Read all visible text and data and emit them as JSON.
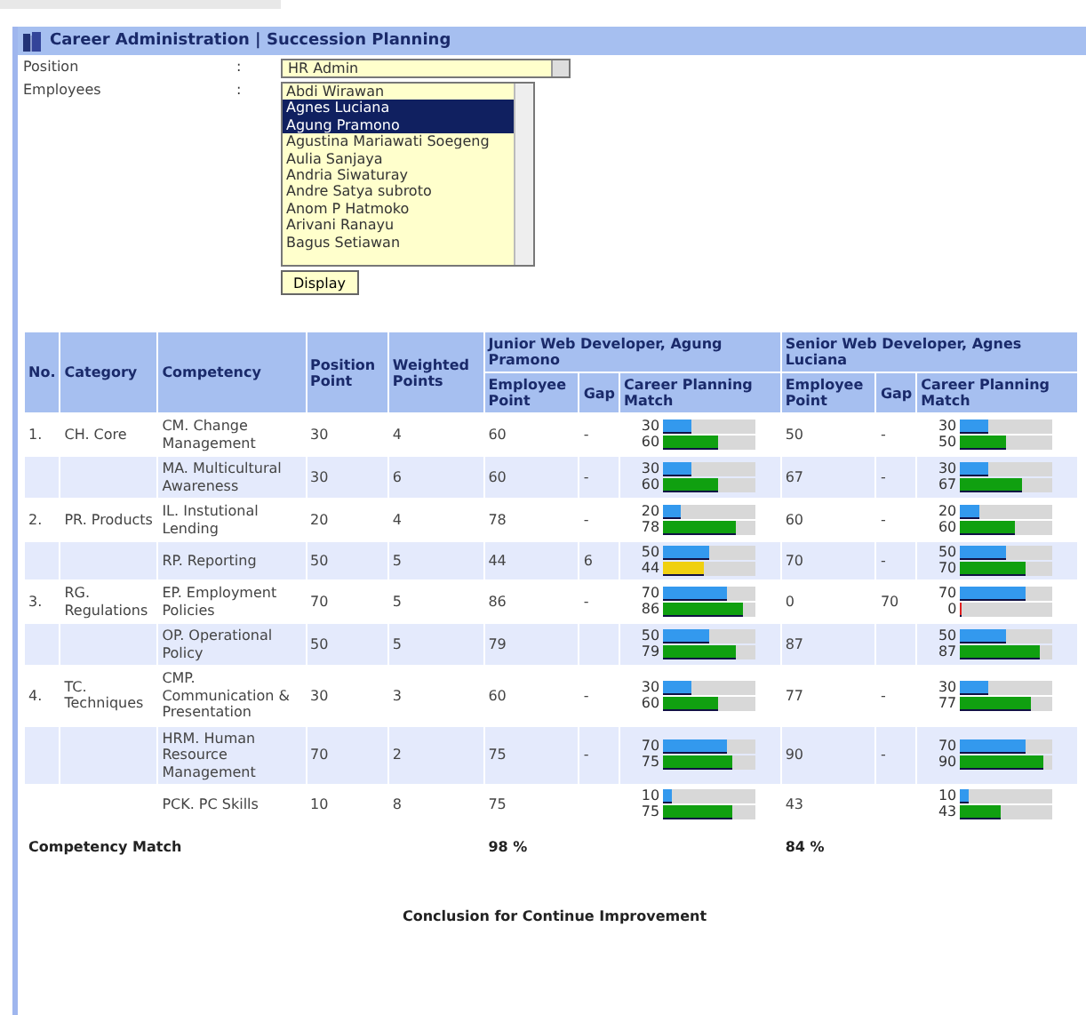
{
  "page": {
    "title": "Career Administration | Succession Planning"
  },
  "form": {
    "position": {
      "label": "Position",
      "separator": ":",
      "value": "HR Admin"
    },
    "employees": {
      "label": "Employees",
      "separator": ":",
      "options": [
        {
          "name": "Abdi Wirawan",
          "selected": false
        },
        {
          "name": "Agnes Luciana",
          "selected": true
        },
        {
          "name": "Agung Pramono",
          "selected": true
        },
        {
          "name": "Agustina Mariawati Soegeng",
          "selected": false
        },
        {
          "name": "Aulia Sanjaya",
          "selected": false
        },
        {
          "name": "Andria Siwaturay",
          "selected": false
        },
        {
          "name": "Andre Satya subroto",
          "selected": false
        },
        {
          "name": "Anom P Hatmoko",
          "selected": false
        },
        {
          "name": "Arivani Ranayu",
          "selected": false
        },
        {
          "name": "Bagus Setiawan",
          "selected": false
        }
      ]
    },
    "display_button": "Display"
  },
  "table": {
    "columns": [
      "No.",
      "Category",
      "Competency",
      "Position Point",
      "Weighted Points"
    ],
    "groups": [
      {
        "title": "Junior Web Developer, Agung Pramono",
        "columns": [
          "Employee Point",
          "Gap",
          "Career Planning Match"
        ]
      },
      {
        "title": "Senior Web Developer, Agnes Luciana",
        "columns": [
          "Employee Point",
          "Gap",
          "Career Planning Match"
        ]
      }
    ],
    "rows": [
      {
        "no": "1.",
        "category": "CH. Core",
        "competency": "CM. Change Management",
        "position_point": "30",
        "weighted_points": "4",
        "results": [
          {
            "employee_point": "60",
            "gap": "-",
            "bars": [
              {
                "label": "30",
                "level": 0.3,
                "color": "#3399ee"
              },
              {
                "label": "60",
                "level": 0.6,
                "color": "#10a010"
              }
            ]
          },
          {
            "employee_point": "50",
            "gap": "-",
            "bars": [
              {
                "label": "30",
                "level": 0.3,
                "color": "#3399ee"
              },
              {
                "label": "50",
                "level": 0.5,
                "color": "#10a010"
              }
            ]
          }
        ]
      },
      {
        "no": "",
        "category": "",
        "competency": "MA. Multicultural Awareness",
        "position_point": "30",
        "weighted_points": "6",
        "results": [
          {
            "employee_point": "60",
            "gap": "-",
            "bars": [
              {
                "label": "30",
                "level": 0.3,
                "color": "#3399ee"
              },
              {
                "label": "60",
                "level": 0.6,
                "color": "#10a010"
              }
            ]
          },
          {
            "employee_point": "67",
            "gap": "-",
            "bars": [
              {
                "label": "30",
                "level": 0.3,
                "color": "#3399ee"
              },
              {
                "label": "67",
                "level": 0.67,
                "color": "#10a010"
              }
            ]
          }
        ]
      },
      {
        "no": "2.",
        "category": "PR. Products",
        "competency": "IL. Instutional Lending",
        "position_point": "20",
        "weighted_points": "4",
        "results": [
          {
            "employee_point": "78",
            "gap": "-",
            "bars": [
              {
                "label": "20",
                "level": 0.2,
                "color": "#3399ee"
              },
              {
                "label": "78",
                "level": 0.78,
                "color": "#10a010"
              }
            ]
          },
          {
            "employee_point": "60",
            "gap": "-",
            "bars": [
              {
                "label": "20",
                "level": 0.2,
                "color": "#3399ee"
              },
              {
                "label": "60",
                "level": 0.6,
                "color": "#10a010"
              }
            ]
          }
        ]
      },
      {
        "no": "",
        "category": "",
        "competency": "RP. Reporting",
        "position_point": "50",
        "weighted_points": "5",
        "results": [
          {
            "employee_point": "44",
            "gap": "6",
            "bars": [
              {
                "label": "50",
                "level": 0.5,
                "color": "#3399ee"
              },
              {
                "label": "44",
                "level": 0.44,
                "color": "#f0d010"
              }
            ]
          },
          {
            "employee_point": "70",
            "gap": "-",
            "bars": [
              {
                "label": "50",
                "level": 0.5,
                "color": "#3399ee"
              },
              {
                "label": "70",
                "level": 0.7,
                "color": "#10a010"
              }
            ]
          }
        ]
      },
      {
        "no": "3.",
        "category": "RG. Regulations",
        "competency": "EP. Employment Policies",
        "position_point": "70",
        "weighted_points": "5",
        "results": [
          {
            "employee_point": "86",
            "gap": "-",
            "bars": [
              {
                "label": "70",
                "level": 0.7,
                "color": "#3399ee"
              },
              {
                "label": "86",
                "level": 0.86,
                "color": "#10a010"
              }
            ]
          },
          {
            "employee_point": "0",
            "gap": "70",
            "bars": [
              {
                "label": "70",
                "level": 0.7,
                "color": "#3399ee"
              },
              {
                "label": "0",
                "level": 0.02,
                "color": "#e02020"
              }
            ]
          }
        ]
      },
      {
        "no": "",
        "category": "",
        "competency": "OP. Operational Policy",
        "position_point": "50",
        "weighted_points": "5",
        "results": [
          {
            "employee_point": "79",
            "bars": [
              {
                "label": "50",
                "level": 0.5,
                "color": "#3399ee"
              },
              {
                "label": "79",
                "level": 0.79,
                "color": "#10a010"
              }
            ]
          },
          {
            "employee_point": "87",
            "bars": [
              {
                "label": "50",
                "level": 0.5,
                "color": "#3399ee"
              },
              {
                "label": "87",
                "level": 0.87,
                "color": "#10a010"
              }
            ]
          }
        ]
      },
      {
        "no": "4.",
        "category": "TC. Techniques",
        "competency": "CMP. Communication & Presentation",
        "position_point": "30",
        "weighted_points": "3",
        "results": [
          {
            "employee_point": "60",
            "gap": "-",
            "bars": [
              {
                "label": "30",
                "level": 0.3,
                "color": "#3399ee"
              },
              {
                "label": "60",
                "level": 0.6,
                "color": "#10a010"
              }
            ]
          },
          {
            "employee_point": "77",
            "gap": "-",
            "bars": [
              {
                "label": "30",
                "level": 0.3,
                "color": "#3399ee"
              },
              {
                "label": "77",
                "level": 0.77,
                "color": "#10a010"
              }
            ]
          }
        ]
      },
      {
        "no": "",
        "category": "",
        "competency": "HRM. Human Resource Management",
        "position_point": "70",
        "weighted_points": "2",
        "results": [
          {
            "employee_point": "75",
            "gap": "-",
            "bars": [
              {
                "label": "70",
                "level": 0.7,
                "color": "#3399ee"
              },
              {
                "label": "75",
                "level": 0.75,
                "color": "#10a010"
              }
            ]
          },
          {
            "employee_point": "90",
            "gap": "-",
            "bars": [
              {
                "label": "70",
                "level": 0.7,
                "color": "#3399ee"
              },
              {
                "label": "90",
                "level": 0.9,
                "color": "#10a010"
              }
            ]
          }
        ]
      },
      {
        "no": "",
        "category": "",
        "competency": "PCK. PC Skills",
        "position_point": "10",
        "weighted_points": "8",
        "results": [
          {
            "employee_point": "75",
            "bars": [
              {
                "label": "10",
                "level": 0.1,
                "color": "#3399ee"
              },
              {
                "label": "75",
                "level": 0.75,
                "color": "#10a010"
              }
            ]
          },
          {
            "employee_point": "43",
            "bars": [
              {
                "label": "10",
                "level": 0.1,
                "color": "#3399ee"
              },
              {
                "label": "43",
                "level": 0.43,
                "color": "#10a010"
              }
            ]
          }
        ]
      }
    ],
    "footer": {
      "label": "Competency Match",
      "values": [
        "98 %",
        "84 %"
      ]
    }
  },
  "conclusion": "Conclusion for Continue Improvement"
}
